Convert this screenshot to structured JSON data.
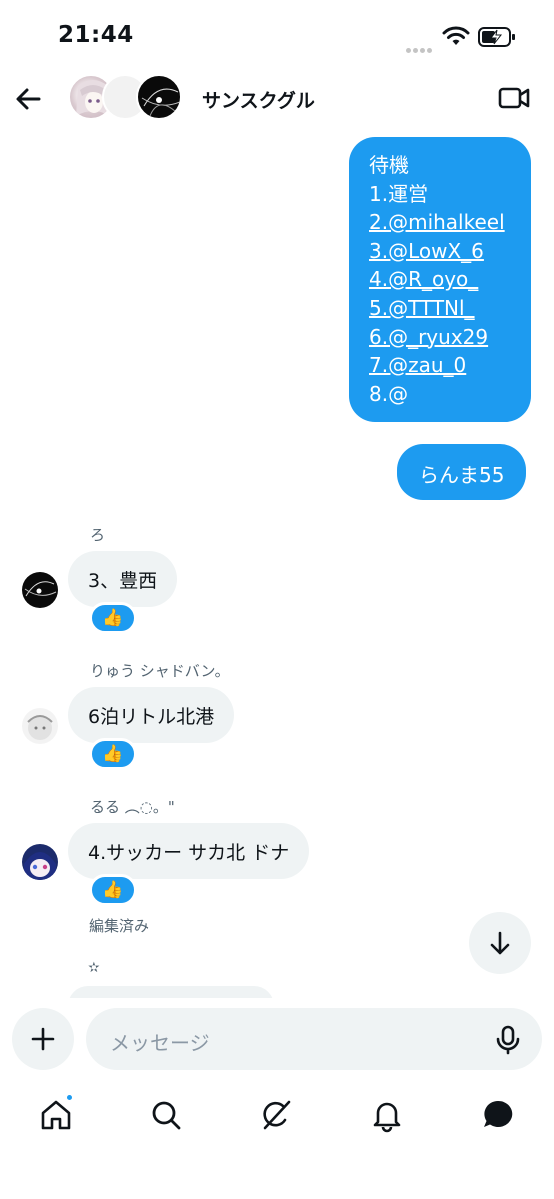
{
  "status_bar": {
    "time": "21:44",
    "icons": [
      "cellular-dots-icon",
      "wifi-icon",
      "battery-charging-icon"
    ]
  },
  "header": {
    "title": "サンスクグル",
    "icons": [
      "back-arrow-icon",
      "video-camera-icon"
    ]
  },
  "outgoing": {
    "list_lines": [
      "待機",
      "1.運営",
      "2.@mihalkeel",
      "3.@LowX_6",
      "4.@R_oyo_",
      "5.@TTTNl_",
      "6.@_ryux29",
      "7.@zau_0",
      "8.@"
    ],
    "short": "らんま55"
  },
  "incoming": [
    {
      "sender": "ろ",
      "text": "3、豊西",
      "reaction": "👍"
    },
    {
      "sender": "りゅう シャドバン。",
      "text": "6泊リトル北港",
      "reaction": "👍"
    },
    {
      "sender": "るる ︵◌。\"",
      "text": "4.サッカー サカ北 ドナ",
      "reaction": "👍",
      "edited": "編集済み"
    }
  ],
  "partial_sender": "✫",
  "composer": {
    "placeholder": "メッセージ"
  },
  "nav": [
    "home-icon",
    "search-icon",
    "grok-icon",
    "notifications-icon",
    "messages-icon"
  ],
  "colors": {
    "accent": "#1d9bf0",
    "bubble_incoming": "#eff3f4",
    "text": "#0f1419",
    "muted": "#536471"
  }
}
